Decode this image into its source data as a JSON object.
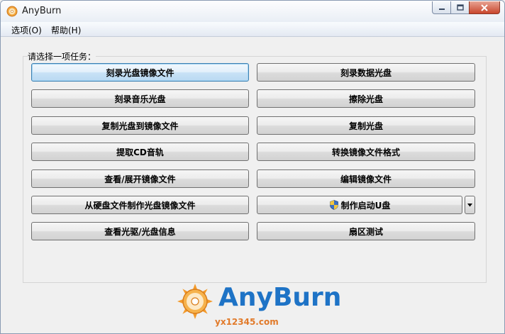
{
  "window": {
    "title": "AnyBurn"
  },
  "menu": [
    {
      "label": "选项(O)"
    },
    {
      "label": "帮助(H)"
    }
  ],
  "task_prompt": "请选择一项任务：",
  "tasks": {
    "left": [
      {
        "label": "刻录光盘镜像文件"
      },
      {
        "label": "刻录音乐光盘"
      },
      {
        "label": "复制光盘到镜像文件"
      },
      {
        "label": "提取CD音轨"
      },
      {
        "label": "查看/展开镜像文件"
      },
      {
        "label": "从硬盘文件制作光盘镜像文件"
      },
      {
        "label": "查看光驱/光盘信息"
      }
    ],
    "right": [
      {
        "label": "刻录数据光盘"
      },
      {
        "label": "擦除光盘"
      },
      {
        "label": "复制光盘"
      },
      {
        "label": "转换镜像文件格式"
      },
      {
        "label": "编辑镜像文件"
      },
      {
        "label": "制作启动U盘"
      },
      {
        "label": "扇区测试"
      }
    ]
  },
  "brand": {
    "name": "AnyBurn",
    "watermark": "yx12345.com"
  },
  "colors": {
    "brand_blue": "#1e73c6",
    "watermark_orange": "#e17a2a",
    "close_red": "#c9462c"
  }
}
